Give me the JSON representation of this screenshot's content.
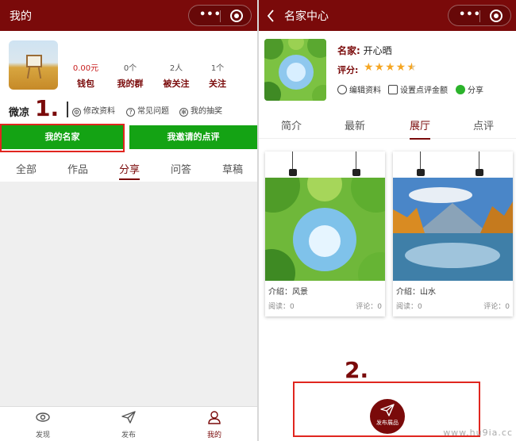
{
  "left": {
    "title": "我的",
    "stats": [
      {
        "value": "0.00元",
        "label": "钱包"
      },
      {
        "value": "0个",
        "label": "我的群"
      },
      {
        "value": "2人",
        "label": "被关注"
      },
      {
        "value": "1个",
        "label": "关注"
      }
    ],
    "username": "微凉",
    "annotation": "1.",
    "links": [
      "修改资料",
      "常见问题",
      "我的抽奖"
    ],
    "buttons": {
      "my_masters": "我的名家",
      "my_invited_reviews": "我邀请的点评"
    },
    "tabs": [
      "全部",
      "作品",
      "分享",
      "问答",
      "草稿"
    ],
    "active_tab": "分享",
    "bottom_nav": [
      {
        "label": "发现",
        "icon": "eye-icon"
      },
      {
        "label": "发布",
        "icon": "send-icon"
      },
      {
        "label": "我的",
        "icon": "user-icon"
      }
    ]
  },
  "right": {
    "title": "名家中心",
    "name_label": "名家:",
    "name_value": "开心晒",
    "rating_label": "评分:",
    "rating": 4.5,
    "stars_text": "★★★★★",
    "actions": [
      "编辑资料",
      "设置点评金额",
      "分享"
    ],
    "tabs": [
      "简介",
      "最新",
      "展厅",
      "点评"
    ],
    "active_tab": "展厅",
    "cards": [
      {
        "desc": "介绍：风景",
        "reads": "阅读：0",
        "comments": "评论：0"
      },
      {
        "desc": "介绍：山水",
        "reads": "阅读：0",
        "comments": "评论：0"
      }
    ],
    "annotation": "2.",
    "publish_button": "发布展品",
    "watermark": "www.hu9ia.cc"
  },
  "colors": {
    "brand": "#7a0a0a",
    "button_green": "#14a314",
    "highlight_red": "#e0261f",
    "star": "#f5a623"
  }
}
